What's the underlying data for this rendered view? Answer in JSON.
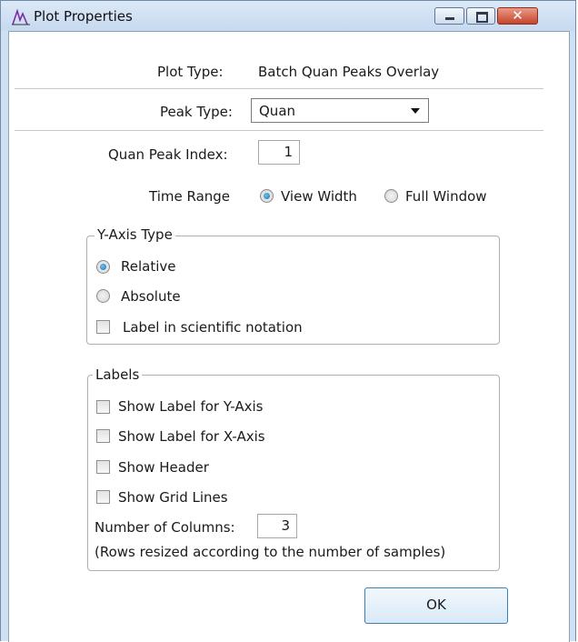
{
  "window": {
    "title": "Plot Properties",
    "close_glyph": "✕"
  },
  "plot_type": {
    "label": "Plot Type:",
    "value": "Batch Quan Peaks Overlay"
  },
  "peak_type": {
    "label": "Peak Type:",
    "selected": "Quan"
  },
  "quan_peak_index": {
    "label": "Quan Peak Index:",
    "value": "1"
  },
  "time_range": {
    "label": "Time Range",
    "options": [
      "View Width",
      "Full Window"
    ],
    "selected": "View Width"
  },
  "y_axis_type": {
    "title": "Y-Axis Type",
    "options": [
      "Relative",
      "Absolute"
    ],
    "selected": "Relative",
    "scientific_label": "Label in scientific notation",
    "scientific_checked": false
  },
  "labels": {
    "title": "Labels",
    "checkboxes": [
      {
        "label": "Show Label for Y-Axis",
        "checked": false
      },
      {
        "label": "Show Label for X-Axis",
        "checked": false
      },
      {
        "label": "Show Header",
        "checked": false
      },
      {
        "label": "Show Grid Lines",
        "checked": false
      }
    ],
    "columns_label": "Number of Columns:",
    "columns_value": "3",
    "rows_note": "(Rows resized according to the number of samples)"
  },
  "buttons": {
    "ok": "OK"
  },
  "icons": {
    "app": "peak-chart-icon",
    "minimize": "minimize-icon",
    "maximize": "maximize-icon",
    "close": "close-icon",
    "dropdown": "chevron-down-icon"
  },
  "colors": {
    "titlebar": "#cfe0f2",
    "close_button": "#c6442c",
    "radio_selected": "#1d6ea8"
  }
}
